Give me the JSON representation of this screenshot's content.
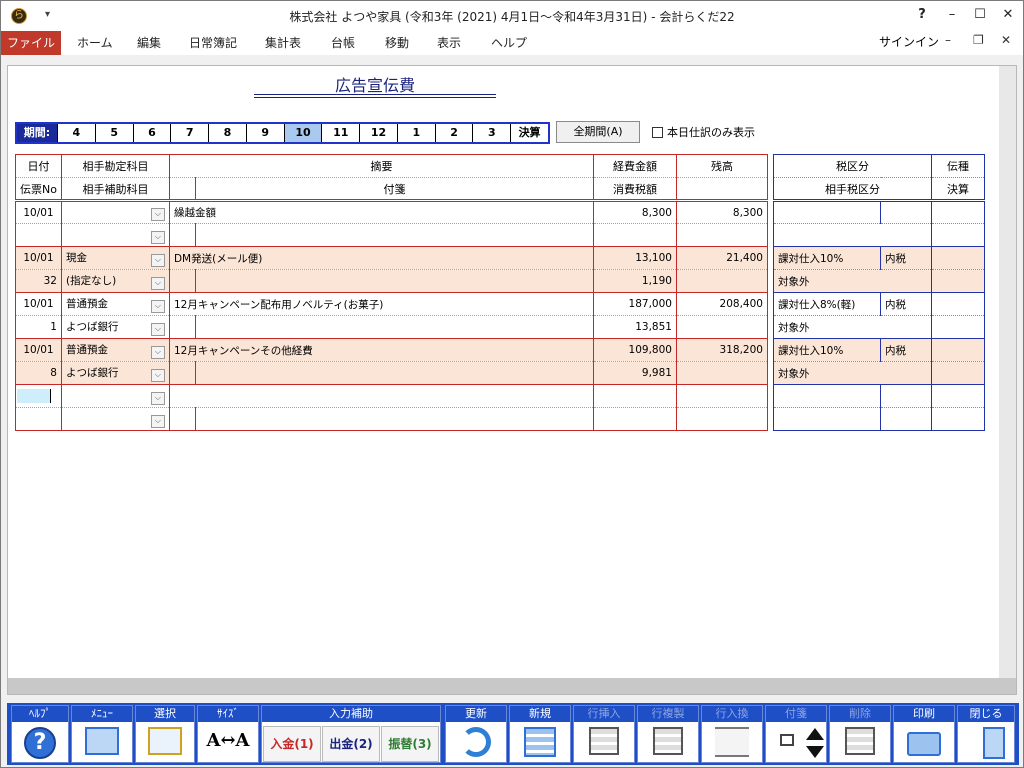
{
  "window": {
    "title": "株式会社 よつや家具 (令和3年 (2021) 4月1日～令和4年3月31日) - 会計らくだ22",
    "help": "?",
    "minimize": "–",
    "maximize": "☐",
    "close": "✕",
    "app_icon": "ら",
    "qa_arrow": "▾"
  },
  "menu": {
    "items": [
      "ファイル",
      "ホーム",
      "編集",
      "日常簿記",
      "集計表",
      "台帳",
      "移動",
      "表示",
      "ヘルプ"
    ],
    "signin": "サインイン",
    "doc_min": "–",
    "doc_restore": "❐",
    "doc_close": "✕"
  },
  "page": {
    "title": "広告宣伝費"
  },
  "period": {
    "label": "期間:",
    "months": [
      "4",
      "5",
      "6",
      "7",
      "8",
      "9",
      "10",
      "11",
      "12",
      "1",
      "2",
      "3",
      "決算"
    ],
    "selected": "10",
    "all_button": "全期間(A)",
    "today_only": "本日仕訳のみ表示"
  },
  "grid": {
    "headers": {
      "date": "日付",
      "voucher": "伝票No",
      "account": "相手勘定科目",
      "subaccount": "相手補助科目",
      "summary": "摘要",
      "memo": "付箋",
      "amount": "経費金額",
      "tax": "消費税額",
      "balance": "残高",
      "tax_class": "税区分",
      "slip_type": "伝種",
      "partner_tax": "相手税区分",
      "settlement": "決算"
    },
    "rows": [
      {
        "date": "10/01",
        "no": "",
        "account": "",
        "sub": "",
        "summary": "繰越金額",
        "memo": "",
        "amount": "8,300",
        "tax": "",
        "balance": "8,300",
        "tax_class": "",
        "incl": "",
        "partner": "",
        "tan": false
      },
      {
        "date": "10/01",
        "no": "32",
        "account": "現金",
        "sub": "(指定なし)",
        "summary": "DM発送(メール便)",
        "memo": "",
        "amount": "13,100",
        "tax": "1,190",
        "balance": "21,400",
        "tax_class": "課対仕入10%",
        "incl": "内税",
        "partner": "対象外",
        "tan": true
      },
      {
        "date": "10/01",
        "no": "1",
        "account": "普通預金",
        "sub": "よつば銀行",
        "summary": "12月キャンペーン配布用ノベルティ(お菓子)",
        "memo": "",
        "amount": "187,000",
        "tax": "13,851",
        "balance": "208,400",
        "tax_class": "課対仕入8%(軽)",
        "incl": "内税",
        "partner": "対象外",
        "tan": false
      },
      {
        "date": "10/01",
        "no": "8",
        "account": "普通預金",
        "sub": "よつば銀行",
        "summary": "12月キャンペーンその他経費",
        "memo": "",
        "amount": "109,800",
        "tax": "9,981",
        "balance": "318,200",
        "tax_class": "課対仕入10%",
        "incl": "内税",
        "partner": "対象外",
        "tan": true
      }
    ]
  },
  "toolbar": {
    "help": "ﾍﾙﾌﾟ",
    "menu": "ﾒﾆｭｰ",
    "select": "選択",
    "size": "ｻｲｽﾞ",
    "input_assist": "入力補助",
    "deposit": "入金(1)",
    "withdraw": "出金(2)",
    "transfer": "振替(3)",
    "update": "更新",
    "new": "新規",
    "row_insert": "行挿入",
    "row_copy": "行複製",
    "row_swap": "行入換",
    "sticky": "付箋",
    "delete": "削除",
    "print": "印刷",
    "close": "閉じる",
    "help_glyph": "?",
    "size_glyph": "A↔A",
    "accent": "#1e4fc7"
  }
}
